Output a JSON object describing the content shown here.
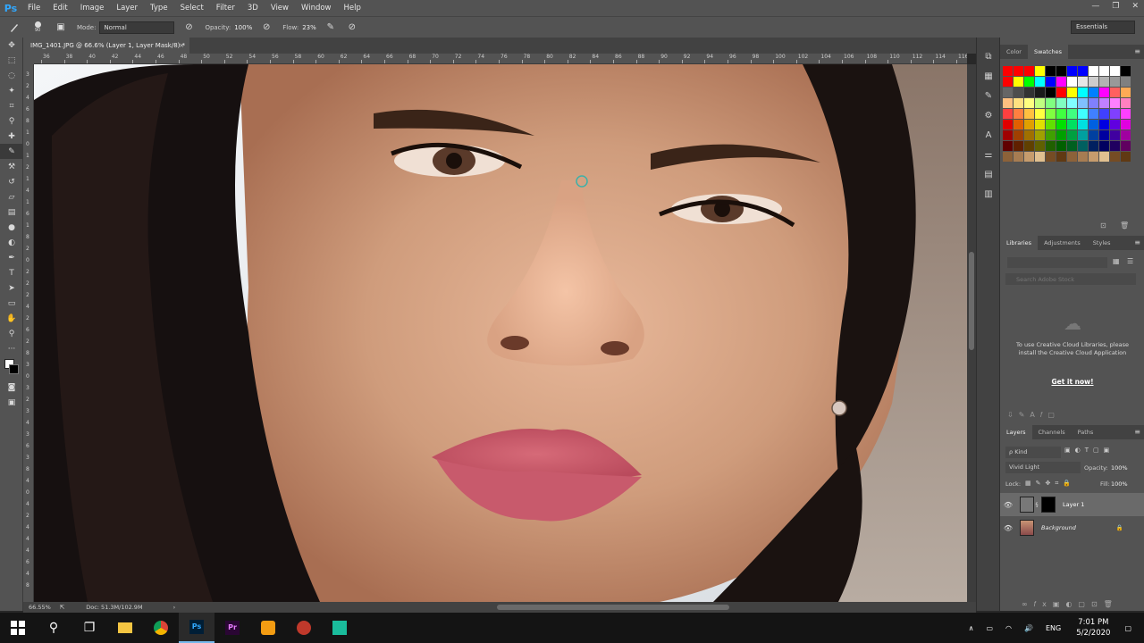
{
  "app": {
    "logo": "Ps"
  },
  "menu": [
    "File",
    "Edit",
    "Image",
    "Layer",
    "Type",
    "Select",
    "Filter",
    "3D",
    "View",
    "Window",
    "Help"
  ],
  "window_controls": [
    "—",
    "❐",
    "✕"
  ],
  "options": {
    "brush_size": "90",
    "mode_label": "Mode:",
    "mode_value": "Normal",
    "opacity_label": "Opacity:",
    "opacity_value": "100%",
    "flow_label": "Flow:",
    "flow_value": "23%",
    "workspace": "Essentials"
  },
  "document": {
    "tab_title": "IMG_1401.JPG @ 66.6% (Layer 1, Layer Mask/8) *",
    "zoom": "66.55%",
    "doc_size": "Doc: 51.3M/102.9M"
  },
  "ruler_top": [
    "36",
    "38",
    "40",
    "42",
    "44",
    "46",
    "48",
    "50",
    "52",
    "54",
    "56",
    "58",
    "60",
    "62",
    "64",
    "66",
    "68",
    "70",
    "72",
    "74",
    "76",
    "78",
    "80",
    "82",
    "84",
    "86",
    "88",
    "90",
    "92",
    "94",
    "96",
    "98",
    "100",
    "102",
    "104",
    "106",
    "108",
    "110",
    "112",
    "114",
    "116"
  ],
  "ruler_left": [
    "3",
    "2",
    "4",
    "6",
    "8",
    "1",
    "0",
    "1",
    "2",
    "1",
    "4",
    "1",
    "6",
    "1",
    "8",
    "2",
    "0",
    "2",
    "2",
    "2",
    "4",
    "2",
    "6",
    "2",
    "8",
    "3",
    "0",
    "3",
    "2",
    "3",
    "4",
    "3",
    "6",
    "3",
    "8",
    "4",
    "0",
    "4",
    "2",
    "4",
    "4",
    "4",
    "6",
    "4",
    "8"
  ],
  "panels": {
    "top_tabs": [
      "Color",
      "Swatches"
    ],
    "top_active": "Swatches",
    "lib_tabs": [
      "Libraries",
      "Adjustments",
      "Styles"
    ],
    "lib_search_placeholder": "Search Adobe Stock",
    "cc_message": "To use Creative Cloud Libraries, please install the Creative Cloud Application",
    "cc_link": "Get it now!",
    "layer_tabs": [
      "Layers",
      "Channels",
      "Paths"
    ],
    "kind_label": "ρ Kind",
    "blend_mode": "Vivid Light",
    "opacity_label": "Opacity:",
    "opacity_value": "100%",
    "lock_label": "Lock:",
    "fill_label": "Fill:",
    "fill_value": "100%",
    "layers": [
      {
        "name": "Layer 1",
        "selected": true
      },
      {
        "name": "Background",
        "selected": false
      }
    ]
  },
  "swatch_colors": [
    "#ff0000",
    "#ff0000",
    "#ff0000",
    "#ffff00",
    "#000000",
    "#000000",
    "#0000ff",
    "#0000ff",
    "#ffffff",
    "#ffffff",
    "#ffffff",
    "#000000",
    "#ff0000",
    "#ffff00",
    "#00ff00",
    "#00ffff",
    "#0000ff",
    "#ff00ff",
    "#ffffff",
    "#e6e6e6",
    "#cccccc",
    "#b3b3b3",
    "#999999",
    "#808080",
    "#666666",
    "#4d4d4d",
    "#333333",
    "#1a1a1a",
    "#000000",
    "#ff0000",
    "#ffff00",
    "#00ffff",
    "#0080ff",
    "#ff00ff",
    "#ff6060",
    "#ffaa55",
    "#ffc080",
    "#ffe080",
    "#ffff80",
    "#c0ff80",
    "#80ff80",
    "#80ffc0",
    "#80ffff",
    "#80c0ff",
    "#8080ff",
    "#c080ff",
    "#ff80ff",
    "#ff80c0",
    "#ff4040",
    "#ff8040",
    "#ffc040",
    "#ffff40",
    "#80ff40",
    "#40ff40",
    "#40ff80",
    "#40ffff",
    "#4080ff",
    "#4040ff",
    "#8040ff",
    "#ff40ff",
    "#e00000",
    "#e06000",
    "#e0a000",
    "#e0e000",
    "#60e000",
    "#00e000",
    "#00e060",
    "#00e0e0",
    "#0060e0",
    "#0000e0",
    "#6000e0",
    "#e000e0",
    "#a00000",
    "#a04000",
    "#a07000",
    "#a0a000",
    "#40a000",
    "#00a000",
    "#00a040",
    "#00a0a0",
    "#0040a0",
    "#0000a0",
    "#4000a0",
    "#a000a0",
    "#600000",
    "#602000",
    "#604000",
    "#606000",
    "#206000",
    "#006000",
    "#006020",
    "#006060",
    "#002060",
    "#000060",
    "#200060",
    "#600060",
    "#8c6239",
    "#a67c52",
    "#c69c6d",
    "#e0c090",
    "#754c24",
    "#603913",
    "#8c6239",
    "#a67c52",
    "#c69c6d",
    "#e0c090",
    "#754c24",
    "#603913"
  ],
  "taskbar": {
    "language": "ENG",
    "time": "7:01 PM",
    "date": "5/2/2020"
  }
}
